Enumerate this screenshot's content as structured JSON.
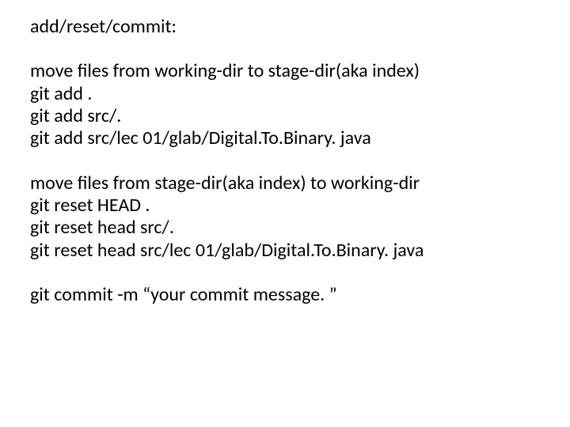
{
  "title": "add/reset/commit:",
  "block1": {
    "desc": "move files from working-dir to stage-dir(aka index)",
    "l1": "git add .",
    "l2": "git add src/.",
    "l3": "git add src/lec 01/glab/Digital.To.Binary. java"
  },
  "block2": {
    "desc": "move files from stage-dir(aka index) to working-dir",
    "l1": "git reset HEAD .",
    "l2": "git reset head src/.",
    "l3": "git reset head src/lec 01/glab/Digital.To.Binary. java"
  },
  "commit_line": "git commit -m “your commit message. ”"
}
